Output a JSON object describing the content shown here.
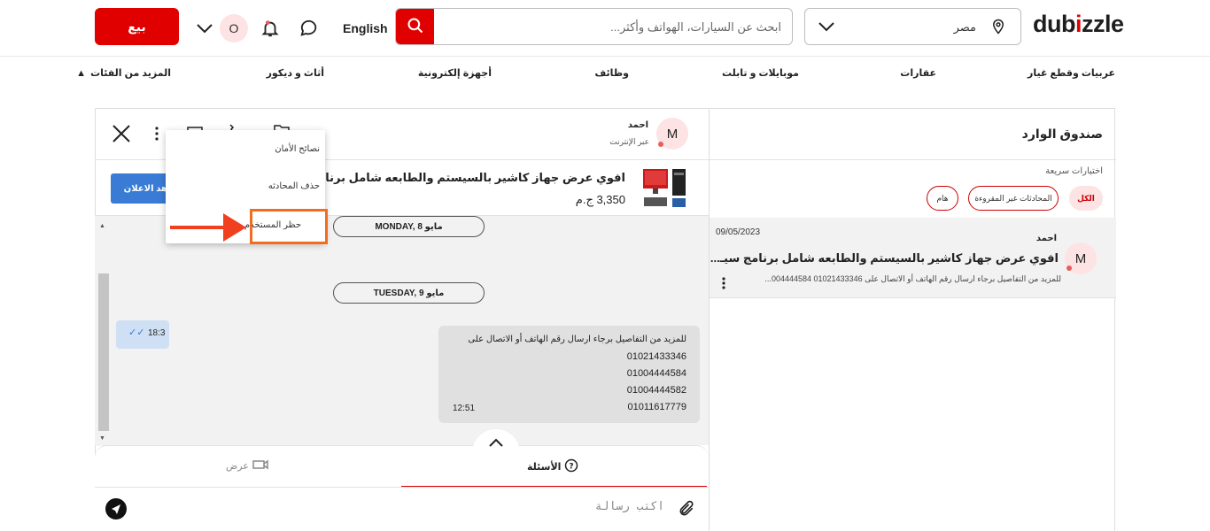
{
  "header": {
    "logo": "dubizzle",
    "location": "مصر",
    "search_placeholder": "ابحث عن السيارات، الهواتف وأكثر...",
    "language": "English",
    "user_initial": "O",
    "sell_label": "بيع"
  },
  "categories": [
    "عربيات وقطع غيار",
    "عقارات",
    "موبايلات و تابلت",
    "وظائف",
    "أجهزة إلكترونية",
    "أثاث و ديكور",
    "المزيد من الفئات"
  ],
  "inbox": {
    "title": "صندوق الوارد",
    "quick_options_label": "اختيارات سريعة",
    "filters": [
      "الكل",
      "المحادثات غير المقروءة",
      "هام"
    ],
    "conversation": {
      "initial": "M",
      "name": "احمد",
      "date": "09/05/2023",
      "title": "افوي عرض جهاز كاشير بالسيستم والطابعه شامل برنامج سيـ...",
      "snippet": "للمزيد من التفاصيل برجاء ارسال رقم الهاتف أو الاتصال على 01021433346 004444584..."
    }
  },
  "chat": {
    "user_initial": "M",
    "user_name": "احمد",
    "user_status": "عبر الإنترنت",
    "product_title": "افوي عرض جهاز كاشير بالسيستم والطابعه شامل برنامج سيستم الكا",
    "product_price": "3,350 ج.م",
    "view_ad_label": "هد الاعلان",
    "days": [
      "MONDAY, 8 مايو",
      "TUESDAY, 9 مايو"
    ],
    "outgoing_time": "18:3",
    "message_lines": [
      "للمزيد من التفاصيل برجاء ارسال رقم الهاتف أو الاتصال على",
      "01021433346",
      "01004444584",
      "01004444582",
      "01011617779"
    ],
    "message_time": "12:51",
    "tabs": {
      "questions": "الأسئلة",
      "offer": "عرض"
    },
    "composer_placeholder": "اكتب رسالة"
  },
  "menu": {
    "items": [
      "نصائح الأمان",
      "حذف المحادثه",
      "حظر المستخدم"
    ]
  },
  "colors": {
    "brand_red": "#e00000",
    "highlight_orange": "#f26d1f",
    "view_ad_blue": "#3a7bd5"
  }
}
